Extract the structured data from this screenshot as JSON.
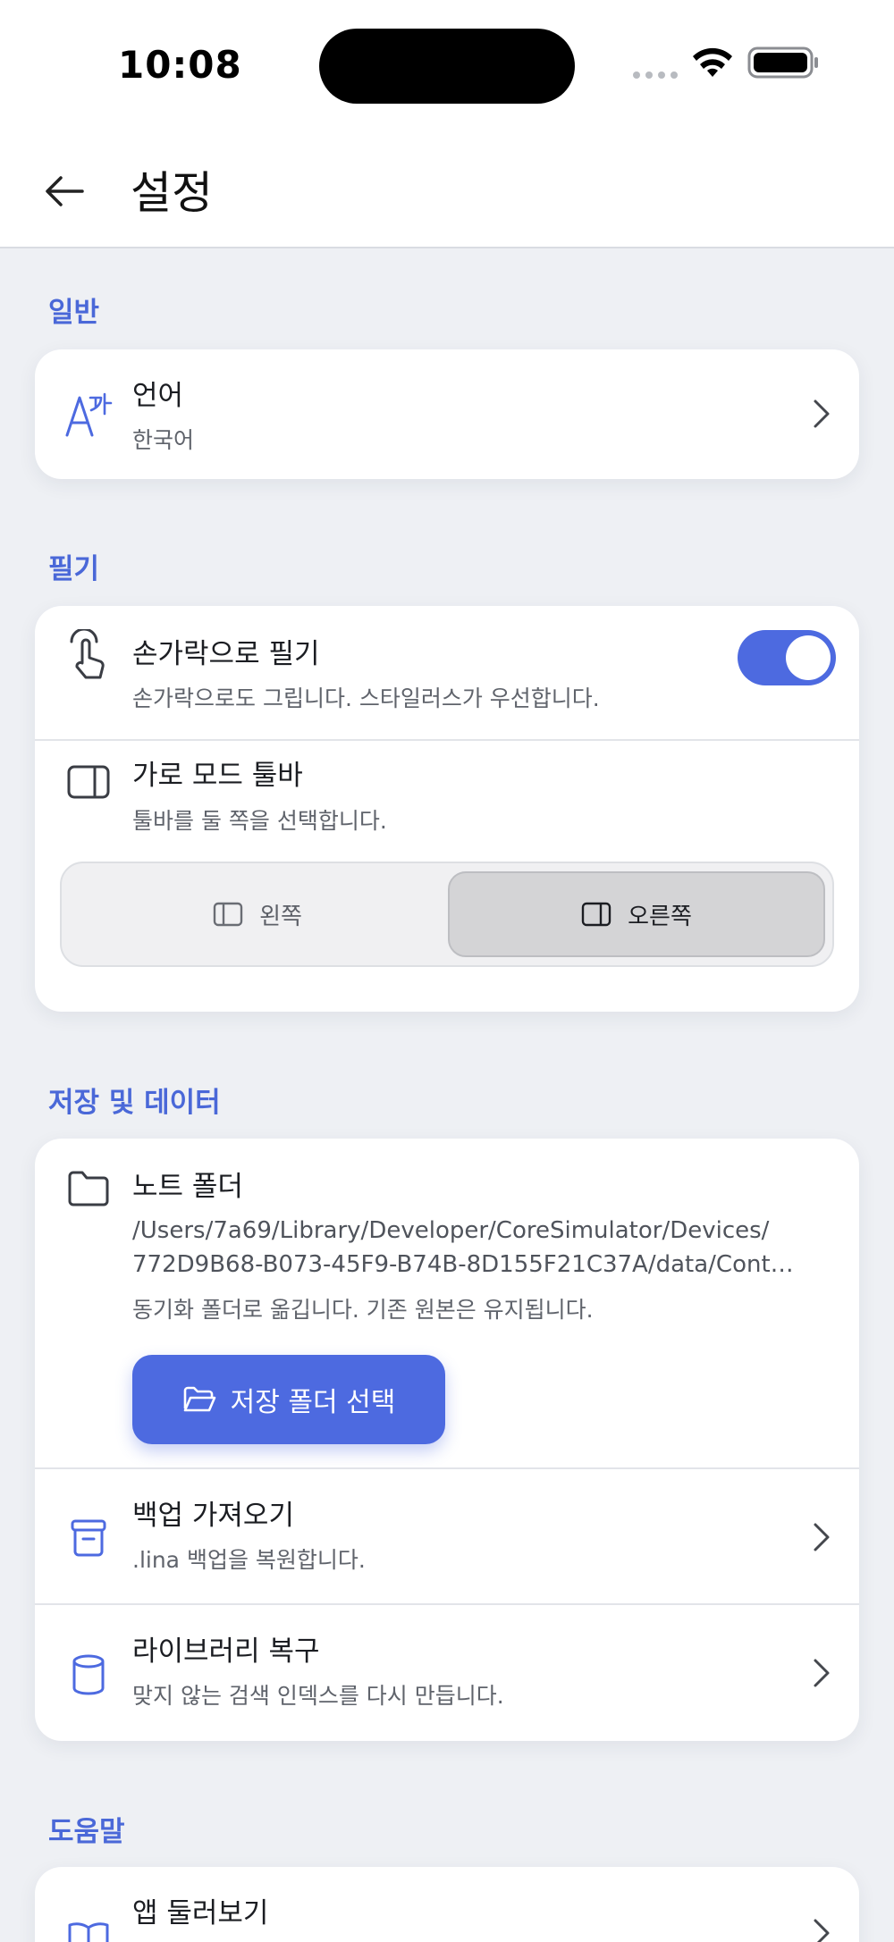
{
  "status_bar": {
    "time": "10:08"
  },
  "app_bar": {
    "title": "설정"
  },
  "sections": {
    "general": {
      "label": "일반",
      "language": {
        "title": "언어",
        "value": "한국어"
      }
    },
    "writing": {
      "label": "필기",
      "finger_writing": {
        "title": "손가락으로 필기",
        "subtitle": "손가락으로도 그립니다. 스타일러스가 우선합니다.",
        "enabled": true
      },
      "landscape_toolbar": {
        "title": "가로 모드 툴바",
        "subtitle": "툴바를 둘 쪽을 선택합니다.",
        "options": [
          "왼쪽",
          "오른쪽"
        ],
        "selected": "오른쪽"
      }
    },
    "storage": {
      "label": "저장 및 데이터",
      "notes_folder": {
        "title": "노트 폴더",
        "path_line1": "/Users/7a69/Library/Developer/CoreSimulator/Devices/",
        "path_line2": "772D9B68-B073-45F9-B74B-8D155F21C37A/data/Cont…",
        "note": "동기화 폴더로 옮깁니다. 기존 원본은 유지됩니다.",
        "button": "저장 폴더 선택"
      },
      "import_backup": {
        "title": "백업 가져오기",
        "subtitle": ".lina 백업을 복원합니다."
      },
      "repair_library": {
        "title": "라이브러리 복구",
        "subtitle": "맞지 않는 검색 인덱스를 다시 만듭니다."
      }
    },
    "help": {
      "label": "도움말",
      "app_tour": {
        "title": "앱 둘러보기"
      }
    }
  },
  "colors": {
    "accent": "#4d6ae0",
    "section_label": "#4a68d8",
    "background": "#eef0f4"
  }
}
